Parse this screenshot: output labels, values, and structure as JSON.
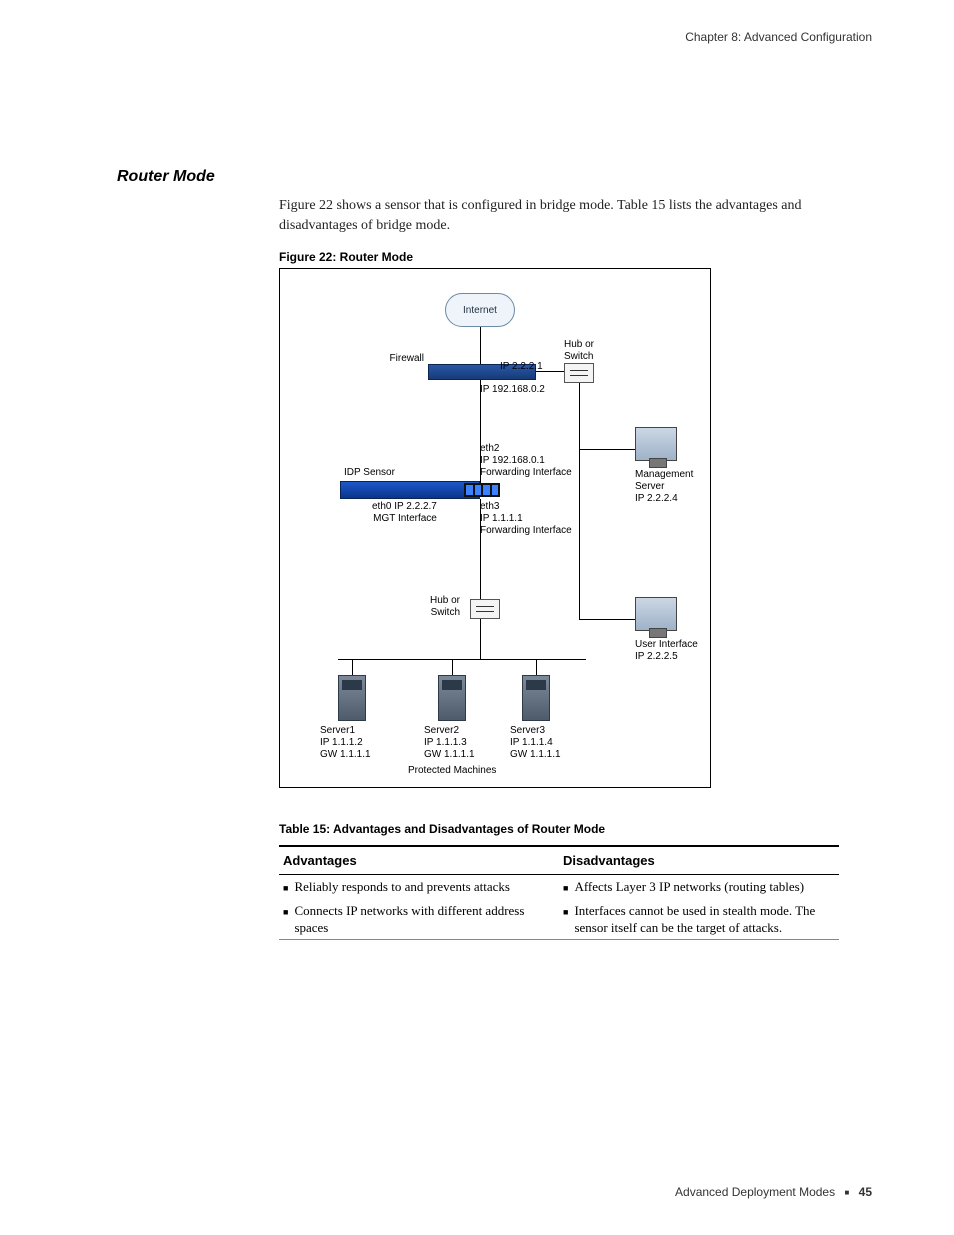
{
  "header": {
    "chapter": "Chapter 8: Advanced Configuration"
  },
  "section": {
    "title": "Router Mode"
  },
  "intro": "Figure 22 shows a sensor that is configured in bridge mode. Table 15 lists the advantages and disadvantages of bridge mode.",
  "figure": {
    "caption": "Figure 22:  Router Mode",
    "labels": {
      "internet": "Internet",
      "firewall": "Firewall",
      "hub1": "Hub or\nSwitch",
      "ip_firewall": "IP 2.2.2.1",
      "ip_below_fw": "IP 192.168.0.2",
      "idp": "IDP Sensor",
      "eth0": "eth0 IP 2.2.2.7\nMGT Interface",
      "eth2": "eth2\nIP 192.168.0.1\nForwarding Interface",
      "eth3": "eth3\nIP 1.1.1.1\nForwarding Interface",
      "mgmt": "Management\nServer\nIP 2.2.2.4",
      "hub2": "Hub or\nSwitch",
      "ui": "User Interface\nIP 2.2.2.5",
      "s1": "Server1\nIP 1.1.1.2\nGW 1.1.1.1",
      "s2": "Server2\nIP 1.1.1.3\nGW 1.1.1.1",
      "s3": "Server3\nIP 1.1.1.4\nGW 1.1.1.1",
      "protected": "Protected Machines"
    }
  },
  "table": {
    "caption": "Table 15:  Advantages and Disadvantages of Router Mode",
    "headers": {
      "adv": "Advantages",
      "dis": "Disadvantages"
    },
    "rows": [
      {
        "adv": "Reliably responds to and prevents attacks",
        "dis": "Affects Layer 3 IP networks (routing tables)"
      },
      {
        "adv": "Connects IP networks with different address spaces",
        "dis": "Interfaces cannot be used in stealth mode. The sensor itself can be the target of attacks."
      }
    ]
  },
  "footer": {
    "section": "Advanced Deployment Modes",
    "page": "45"
  }
}
